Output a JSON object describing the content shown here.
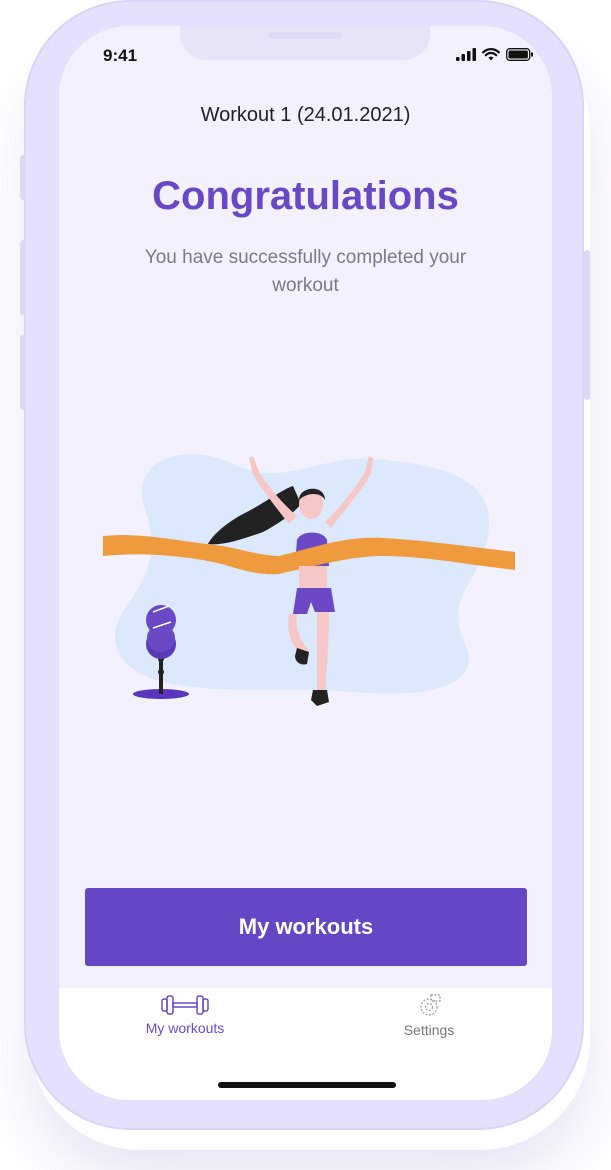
{
  "status_bar": {
    "time": "9:41"
  },
  "header": {
    "workout_title": "Workout  1 (24.01.2021)"
  },
  "main": {
    "heading": "Congratulations",
    "message": "You have successfully completed your workout",
    "illustration_icon": "finish-line-runner-illustration"
  },
  "primary_button": {
    "label": "My workouts"
  },
  "tabbar": {
    "tabs": [
      {
        "label": "My workouts",
        "icon": "dumbbell-icon",
        "active": true
      },
      {
        "label": "Settings",
        "icon": "settings-gear-icon",
        "active": false
      }
    ]
  },
  "colors": {
    "accent": "#6547c5",
    "background": "#f2f1fd",
    "ribbon": "#f09a3e",
    "blob": "#dce8fb"
  }
}
